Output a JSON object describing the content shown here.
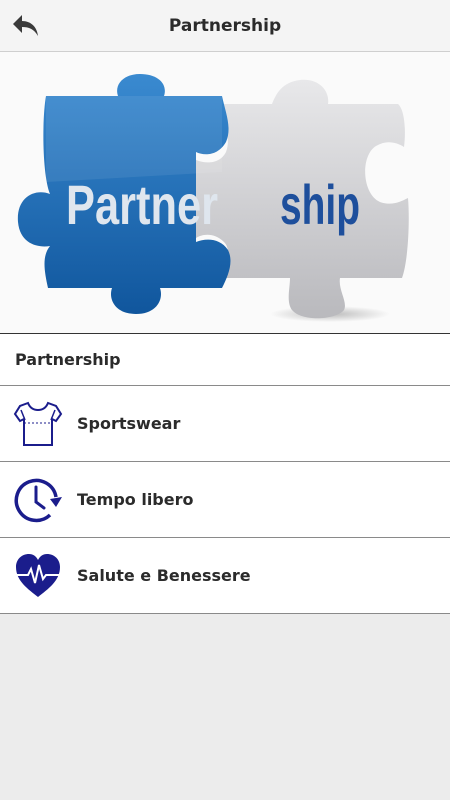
{
  "header": {
    "title": "Partnership",
    "back_icon": "back-arrow-icon"
  },
  "banner": {
    "word_left": "Partner",
    "word_right": "ship"
  },
  "section": {
    "title": "Partnership"
  },
  "items": [
    {
      "label": "Sportswear",
      "icon": "tshirt-icon"
    },
    {
      "label": "Tempo libero",
      "icon": "clock-icon"
    },
    {
      "label": "Salute e Benessere",
      "icon": "heart-pulse-icon"
    }
  ],
  "colors": {
    "accent": "#1b1d8c",
    "puzzle_blue": "#1f6fb8",
    "puzzle_grey": "#c9c9cc"
  }
}
